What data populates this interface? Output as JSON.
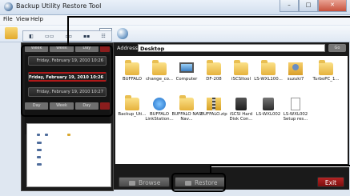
{
  "window": {
    "title": "Backup Utility Restore Tool",
    "buttons": [
      "–",
      "□",
      "✕"
    ]
  },
  "menu": {
    "items": [
      "File",
      "View",
      "Help"
    ]
  },
  "viewbar": {
    "items": [
      "◧",
      "▭▭",
      "▫▫",
      "▪▪",
      "☷"
    ]
  },
  "tabs_top": {
    "left": "Week",
    "mid": "Week",
    "right": "Day"
  },
  "tabs_bottom": {
    "left": "Day",
    "mid": "Week",
    "right": "Day"
  },
  "backups": [
    {
      "label": "Friday, February 19, 2010 10:26"
    },
    {
      "label": "Friday, February 19, 2010 10:26"
    },
    {
      "label": "Friday, February 19, 2010 10:27"
    }
  ],
  "address": {
    "label": "Address",
    "value": "Desktop",
    "go": "Go"
  },
  "files": [
    {
      "name": "BUFFALO",
      "icon": "folder-icon"
    },
    {
      "name": "change_co...",
      "icon": "folder-icon"
    },
    {
      "name": "Computer",
      "icon": "computer-icon"
    },
    {
      "name": "DF-208",
      "icon": "folder-icon"
    },
    {
      "name": "iSCSItool",
      "icon": "folder-icon"
    },
    {
      "name": "LS-WXL100...",
      "icon": "folder-icon"
    },
    {
      "name": "suzuki7",
      "icon": "user-folder-icon"
    },
    {
      "name": "TurboPC_1...",
      "icon": "folder-icon"
    },
    {
      "name": "Backup_Uti...",
      "icon": "folder-icon"
    },
    {
      "name": "BUFFALO LinkStation...",
      "icon": "ie-icon"
    },
    {
      "name": "BUFFALO NAS Nav...",
      "icon": "folder-icon"
    },
    {
      "name": "BUFFALO.zip",
      "icon": "zip-icon"
    },
    {
      "name": "iSCSI Hard Disk Con...",
      "icon": "disk-icon"
    },
    {
      "name": "LS-WXL002",
      "icon": "drive-icon"
    },
    {
      "name": "LS-WXL002 Setup res...",
      "icon": "document-icon"
    }
  ],
  "buttons": {
    "browse": "Browse",
    "restore": "Restore",
    "exit": "Exit"
  }
}
